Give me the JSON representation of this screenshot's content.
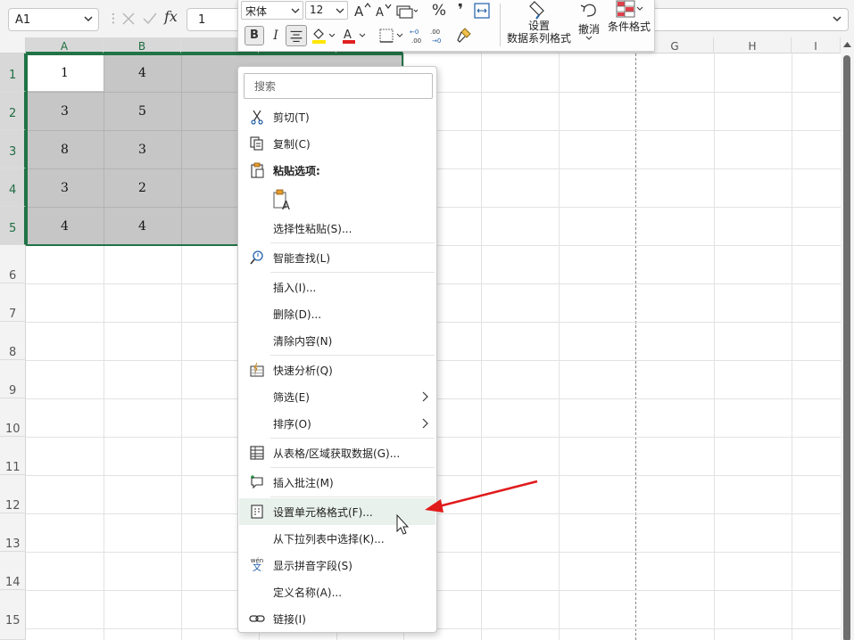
{
  "formula_bar": {
    "name_box": "A1",
    "fx_label": "fx",
    "content": "1"
  },
  "columns": [
    "A",
    "B",
    "",
    "",
    "",
    "",
    "",
    "G",
    "H",
    "I"
  ],
  "rows": [
    "1",
    "2",
    "3",
    "4",
    "5",
    "6",
    "7",
    "8",
    "9",
    "10",
    "11",
    "12",
    "13",
    "14",
    "15"
  ],
  "cells": [
    [
      "1",
      "4"
    ],
    [
      "3",
      "5"
    ],
    [
      "8",
      "3"
    ],
    [
      "3",
      "2"
    ],
    [
      "4",
      "4"
    ]
  ],
  "mini_toolbar": {
    "font": "宋体",
    "size": "12",
    "bold": "B",
    "italic": "I",
    "currency": "%",
    "comma": "❜",
    "format_series_line1": "设置",
    "format_series_line2": "数据系列格式",
    "undo": "撤消",
    "conditional_format": "条件格式"
  },
  "context_menu": {
    "search_placeholder": "搜索",
    "cut": "剪切(T)",
    "copy": "复制(C)",
    "paste_options": "粘贴选项:",
    "paste_special": "选择性粘贴(S)...",
    "smart_lookup": "智能查找(L)",
    "insert": "插入(I)...",
    "delete": "删除(D)...",
    "clear_contents": "清除内容(N)",
    "quick_analysis": "快速分析(Q)",
    "filter": "筛选(E)",
    "sort": "排序(O)",
    "get_data": "从表格/区域获取数据(G)...",
    "insert_comment": "插入批注(M)",
    "format_cells": "设置单元格格式(F)...",
    "pick_from_list": "从下拉列表中选择(K)...",
    "show_phonetic": "显示拼音字段(S)",
    "define_name": "定义名称(A)...",
    "link": "链接(I)",
    "phonetic_icon_text": "wén",
    "phonetic_icon_char": "文"
  },
  "colors": {
    "excel_green": "#217346",
    "selection_fill": "#c6c6c6",
    "highlight_row": "#e8f1ec",
    "annotation_arrow": "#e01b1b"
  }
}
